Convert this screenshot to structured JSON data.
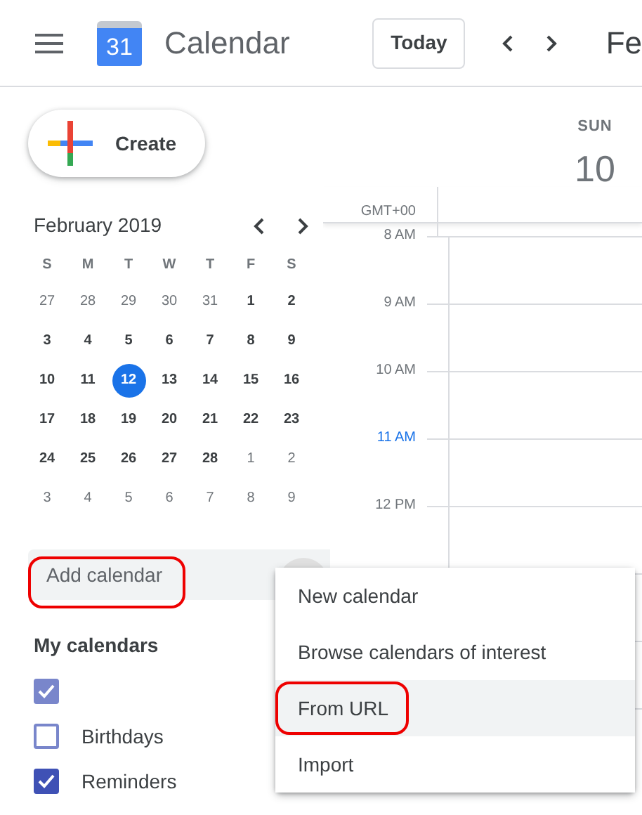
{
  "header": {
    "logo_text": "31",
    "app_title": "Calendar",
    "today_button": "Today",
    "period_title": "Fe"
  },
  "create_button": "Create",
  "mini_calendar": {
    "title": "February 2019",
    "weekdays": [
      "S",
      "M",
      "T",
      "W",
      "T",
      "F",
      "S"
    ],
    "weeks": [
      [
        {
          "day": "27",
          "in_month": false,
          "selected": false
        },
        {
          "day": "28",
          "in_month": false,
          "selected": false
        },
        {
          "day": "29",
          "in_month": false,
          "selected": false
        },
        {
          "day": "30",
          "in_month": false,
          "selected": false
        },
        {
          "day": "31",
          "in_month": false,
          "selected": false
        },
        {
          "day": "1",
          "in_month": true,
          "selected": false
        },
        {
          "day": "2",
          "in_month": true,
          "selected": false
        }
      ],
      [
        {
          "day": "3",
          "in_month": true,
          "selected": false
        },
        {
          "day": "4",
          "in_month": true,
          "selected": false
        },
        {
          "day": "5",
          "in_month": true,
          "selected": false
        },
        {
          "day": "6",
          "in_month": true,
          "selected": false
        },
        {
          "day": "7",
          "in_month": true,
          "selected": false
        },
        {
          "day": "8",
          "in_month": true,
          "selected": false
        },
        {
          "day": "9",
          "in_month": true,
          "selected": false
        }
      ],
      [
        {
          "day": "10",
          "in_month": true,
          "selected": false
        },
        {
          "day": "11",
          "in_month": true,
          "selected": false
        },
        {
          "day": "12",
          "in_month": true,
          "selected": true
        },
        {
          "day": "13",
          "in_month": true,
          "selected": false
        },
        {
          "day": "14",
          "in_month": true,
          "selected": false
        },
        {
          "day": "15",
          "in_month": true,
          "selected": false
        },
        {
          "day": "16",
          "in_month": true,
          "selected": false
        }
      ],
      [
        {
          "day": "17",
          "in_month": true,
          "selected": false
        },
        {
          "day": "18",
          "in_month": true,
          "selected": false
        },
        {
          "day": "19",
          "in_month": true,
          "selected": false
        },
        {
          "day": "20",
          "in_month": true,
          "selected": false
        },
        {
          "day": "21",
          "in_month": true,
          "selected": false
        },
        {
          "day": "22",
          "in_month": true,
          "selected": false
        },
        {
          "day": "23",
          "in_month": true,
          "selected": false
        }
      ],
      [
        {
          "day": "24",
          "in_month": true,
          "selected": false
        },
        {
          "day": "25",
          "in_month": true,
          "selected": false
        },
        {
          "day": "26",
          "in_month": true,
          "selected": false
        },
        {
          "day": "27",
          "in_month": true,
          "selected": false
        },
        {
          "day": "28",
          "in_month": true,
          "selected": false
        },
        {
          "day": "1",
          "in_month": false,
          "selected": false
        },
        {
          "day": "2",
          "in_month": false,
          "selected": false
        }
      ],
      [
        {
          "day": "3",
          "in_month": false,
          "selected": false
        },
        {
          "day": "4",
          "in_month": false,
          "selected": false
        },
        {
          "day": "5",
          "in_month": false,
          "selected": false
        },
        {
          "day": "6",
          "in_month": false,
          "selected": false
        },
        {
          "day": "7",
          "in_month": false,
          "selected": false
        },
        {
          "day": "8",
          "in_month": false,
          "selected": false
        },
        {
          "day": "9",
          "in_month": false,
          "selected": false
        }
      ]
    ]
  },
  "add_calendar": {
    "placeholder": "Add calendar",
    "annotated": true
  },
  "my_calendars": {
    "title": "My calendars",
    "items": [
      {
        "checked": true,
        "color": "#7986cb"
      },
      {
        "label": "Birthdays",
        "checked": false,
        "color": "#7986cb"
      },
      {
        "label": "Reminders",
        "checked": true,
        "color": "#3f51b5"
      }
    ]
  },
  "day_header": {
    "weekday": "SUN",
    "date": "10"
  },
  "timezone": "GMT+00",
  "time_slots": [
    {
      "label": "8 AM",
      "current": false
    },
    {
      "label": "9 AM",
      "current": false
    },
    {
      "label": "10 AM",
      "current": false
    },
    {
      "label": "11 AM",
      "current": true
    },
    {
      "label": "12 PM",
      "current": false
    }
  ],
  "add_menu": [
    {
      "label": "New calendar",
      "selected": false,
      "annotated": false
    },
    {
      "label": "Browse calendars of interest",
      "selected": false,
      "annotated": false
    },
    {
      "label": "From URL",
      "selected": true,
      "annotated": true
    },
    {
      "label": "Import",
      "selected": false,
      "annotated": false
    }
  ]
}
